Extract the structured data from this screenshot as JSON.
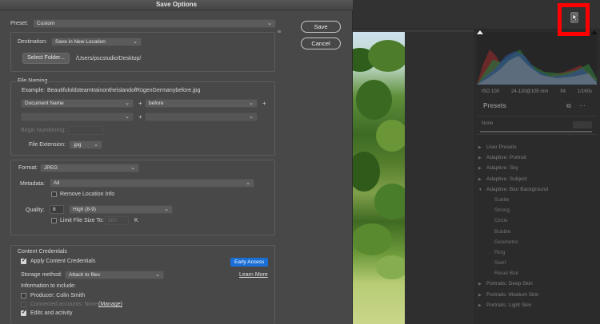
{
  "dialog": {
    "title": "Save Options",
    "preset_label": "Preset:",
    "preset_value": "Custom",
    "save_label": "Save",
    "cancel_label": "Cancel"
  },
  "destination": {
    "label": "Destination:",
    "value": "Save in New Location",
    "select_folder_label": "Select Folder...",
    "path": "/Users/pscstudio/Desktop/"
  },
  "file_naming": {
    "title": "File Naming",
    "example_label": "Example:",
    "example_value": "BeautifuloldsteamtrainontheislandofRügenGermanybefore.jpg",
    "field1": "Document Name",
    "field2": "before",
    "begin_numbering_label": "Begin Numbering:",
    "extension_label": "File Extension:",
    "extension_value": ".jpg",
    "plus": "+"
  },
  "format": {
    "label": "Format:",
    "value": "JPEG",
    "metadata_label": "Metadata:",
    "metadata_value": "All",
    "remove_location_label": "Remove Location Info",
    "quality_label": "Quality:",
    "quality_value": "8",
    "quality_level": "High  (8-9)",
    "limit_size_label": "Limit File Size To:",
    "limit_size_value": "500",
    "limit_size_unit": "K"
  },
  "credentials": {
    "title": "Content Credentials",
    "apply_label": "Apply Content Credentials",
    "early_access": "Early Access",
    "storage_label": "Storage method:",
    "storage_value": "Attach to files",
    "learn_more": "Learn More",
    "info_label": "Information to include:",
    "producer_label": "Producer: Colin Smith",
    "connected_label": "Connected accounts: None",
    "manage_label": "(Manage)",
    "edits_label": "Edits and activity"
  },
  "rail": {
    "histo_info": [
      "ISO 100",
      "24-120@105 mm",
      "f/4",
      "1/160s"
    ],
    "presets_title": "Presets",
    "presets_none": "None",
    "preset_items": [
      {
        "label": "User Presets",
        "kind": "group",
        "arrow": "▶"
      },
      {
        "label": "Adaptive: Portrait",
        "kind": "group",
        "arrow": "▶"
      },
      {
        "label": "Adaptive: Sky",
        "kind": "group",
        "arrow": "▶"
      },
      {
        "label": "Adaptive: Subject",
        "kind": "group",
        "arrow": "▶"
      },
      {
        "label": "Adaptive: Blur Background",
        "kind": "group",
        "arrow": "▼"
      },
      {
        "label": "Subtle",
        "kind": "child",
        "arrow": ""
      },
      {
        "label": "Strong",
        "kind": "child",
        "arrow": ""
      },
      {
        "label": "Circle",
        "kind": "child",
        "arrow": ""
      },
      {
        "label": "Bubble",
        "kind": "child",
        "arrow": ""
      },
      {
        "label": "Geometric",
        "kind": "child",
        "arrow": ""
      },
      {
        "label": "Ring",
        "kind": "child",
        "arrow": ""
      },
      {
        "label": "Swirl",
        "kind": "child",
        "arrow": ""
      },
      {
        "label": "Reset Blur",
        "kind": "child",
        "arrow": ""
      },
      {
        "label": "Portraits: Deep Skin",
        "kind": "group",
        "arrow": "▶"
      },
      {
        "label": "Portraits: Medium Skin",
        "kind": "group",
        "arrow": "▶"
      },
      {
        "label": "Portraits: Light Skin",
        "kind": "group",
        "arrow": "▶"
      }
    ]
  },
  "colors": {
    "highlight": "#ff0000",
    "accent_blue": "#1a6fd6"
  }
}
